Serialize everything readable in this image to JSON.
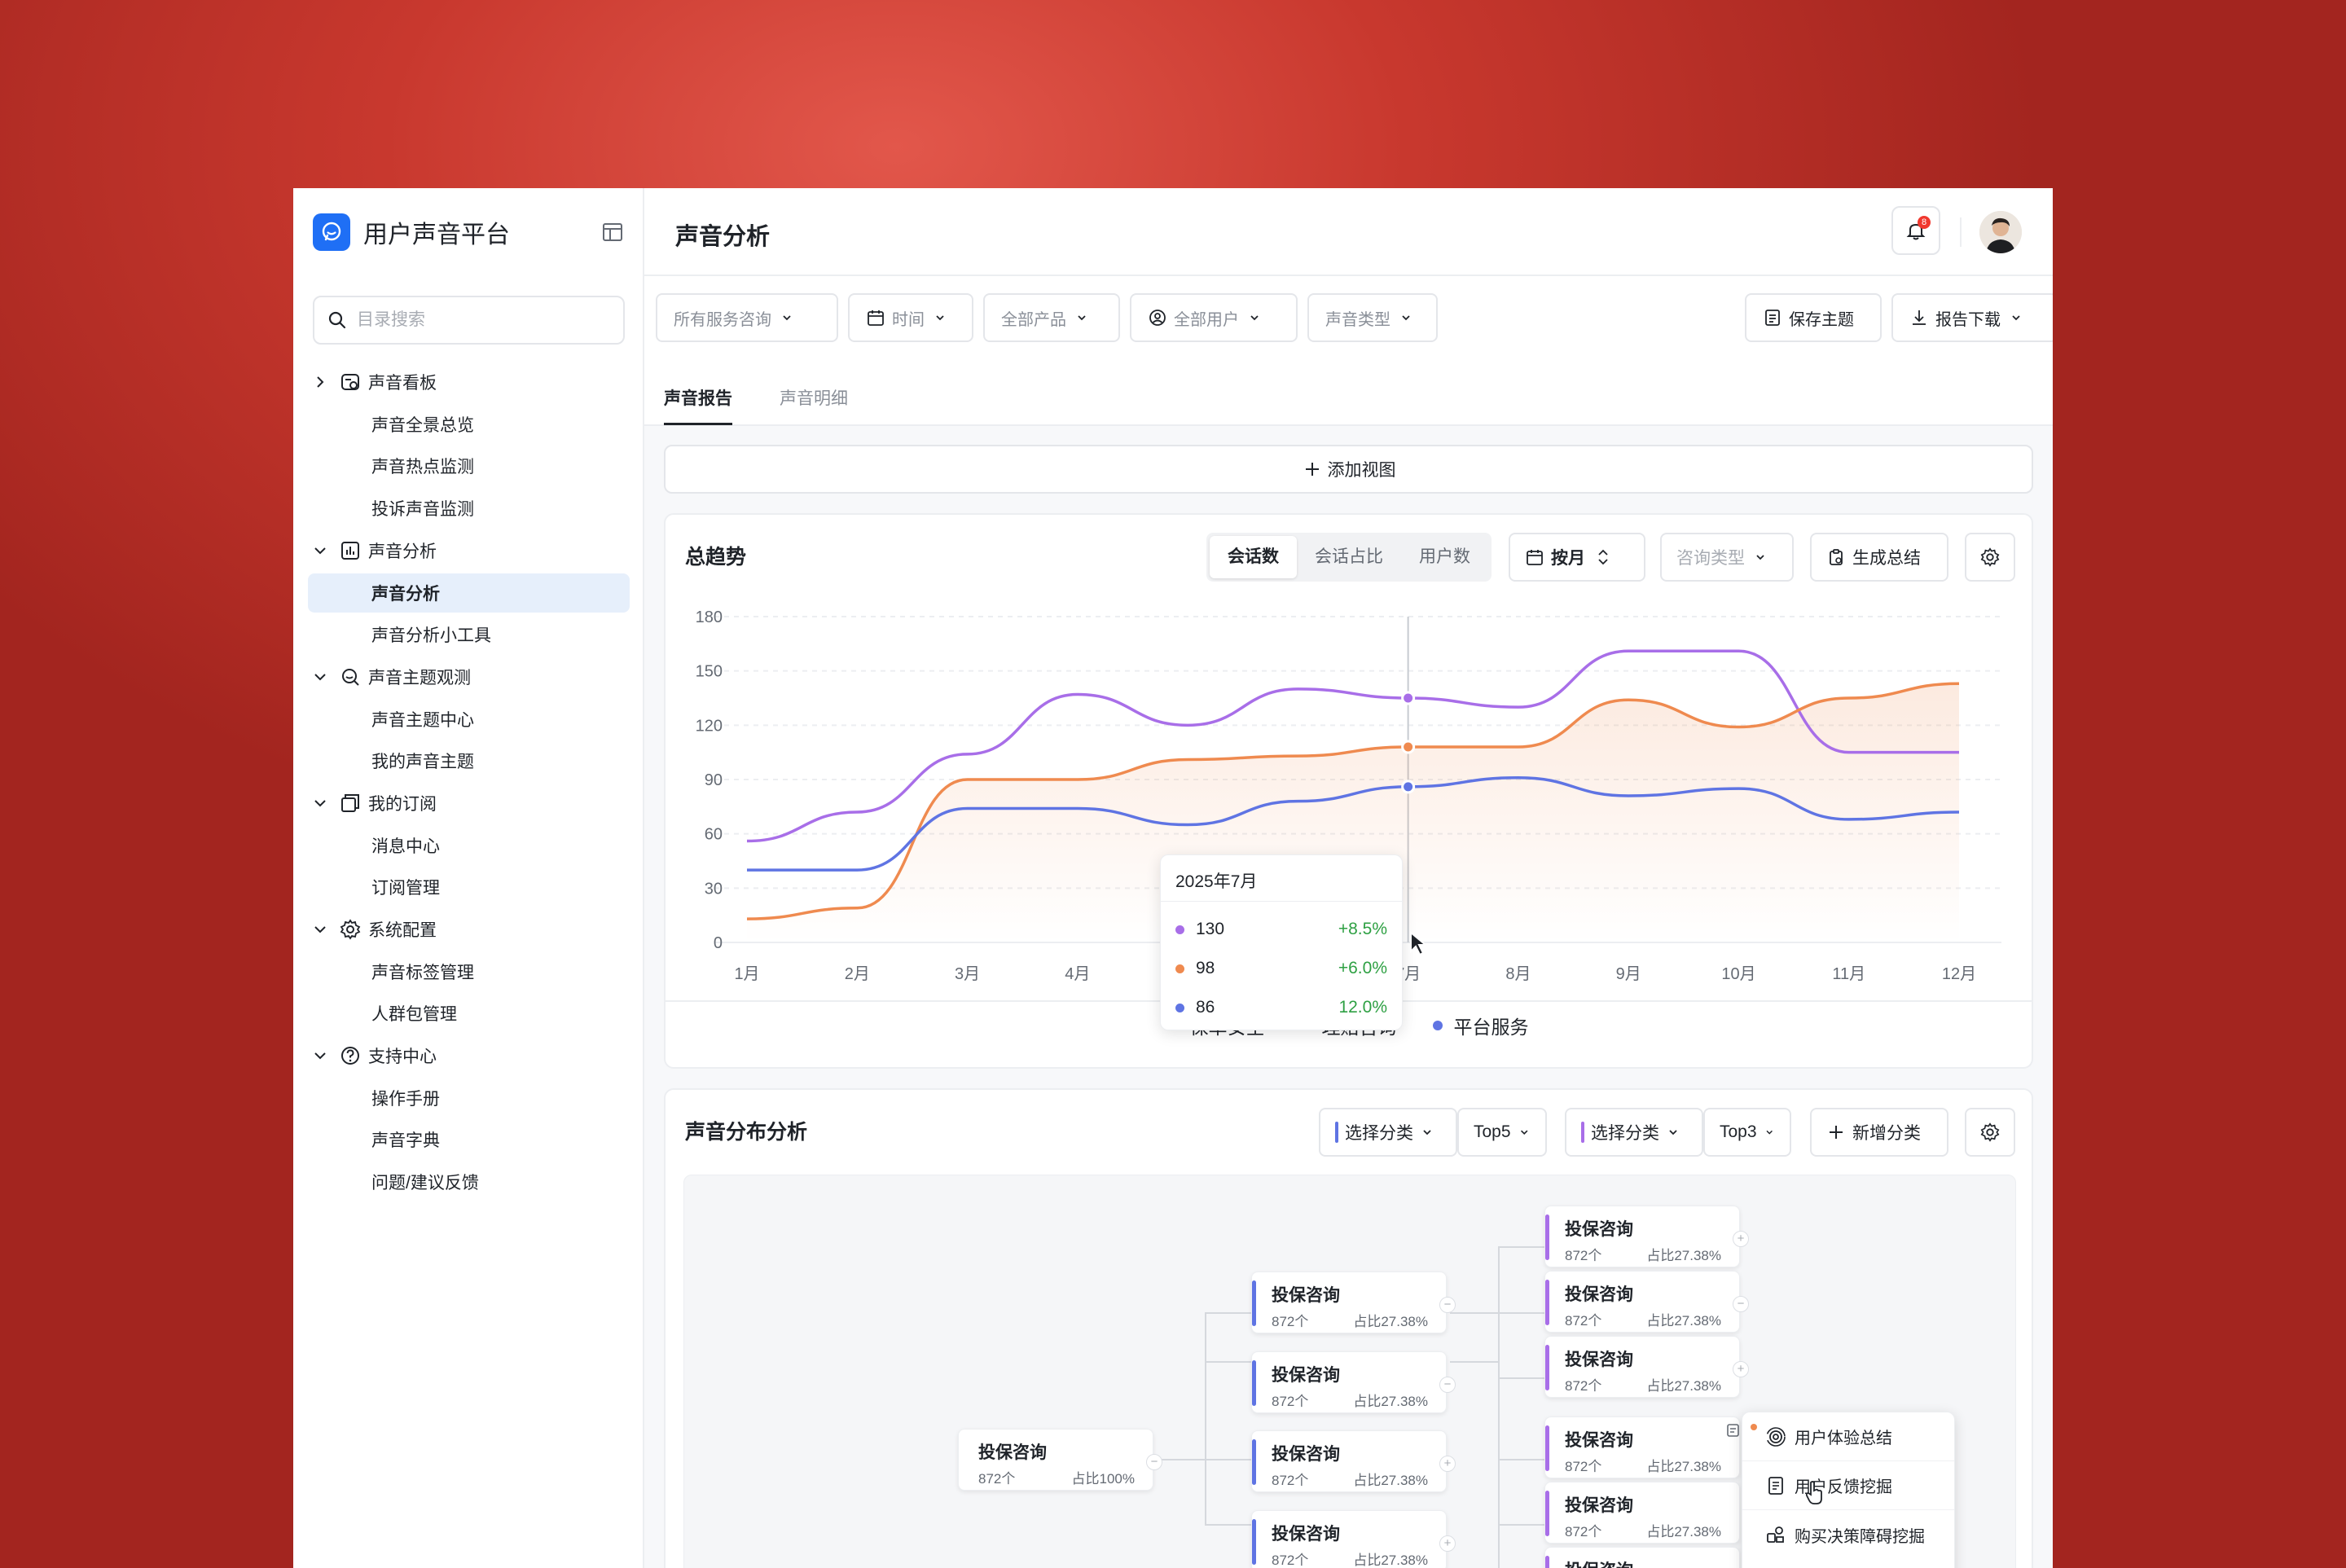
{
  "app": {
    "title": "用户声音平台"
  },
  "sidebar": {
    "search_placeholder": "目录搜索",
    "groups": [
      {
        "label": "声音看板",
        "items": [
          "声音全景总览",
          "声音热点监测",
          "投诉声音监测"
        ]
      },
      {
        "label": "声音分析",
        "items": [
          "声音分析",
          "声音分析小工具"
        ]
      },
      {
        "label": "声音主题观测",
        "items": [
          "声音主题中心",
          "我的声音主题"
        ]
      },
      {
        "label": "我的订阅",
        "items": [
          "消息中心",
          "订阅管理"
        ]
      },
      {
        "label": "系统配置",
        "items": [
          "声音标签管理",
          "人群包管理"
        ]
      },
      {
        "label": "支持中心",
        "items": [
          "操作手册",
          "声音字典",
          "问题/建议反馈"
        ]
      }
    ]
  },
  "header": {
    "title": "声音分析",
    "notification_count": "8"
  },
  "filters": {
    "service": "所有服务咨询",
    "time": "时间",
    "product": "全部产品",
    "users": "全部用户",
    "voice_type": "声音类型",
    "save_theme": "保存主题",
    "download": "报告下载"
  },
  "tabs": [
    "声音报告",
    "声音明细"
  ],
  "add_view": "添加视图",
  "trend_card": {
    "title": "总趋势",
    "segments": [
      "会话数",
      "会话占比",
      "用户数"
    ],
    "period": "按月",
    "consult_type": "咨询类型",
    "generate": "生成总结",
    "tooltip": {
      "title": "2025年7月",
      "rows": [
        {
          "value": "130",
          "change": "+8.5%"
        },
        {
          "value": "98",
          "change": "+6.0%"
        },
        {
          "value": "86",
          "change": "12.0%"
        }
      ]
    }
  },
  "chart_data": {
    "type": "line",
    "categories": [
      "1月",
      "2月",
      "3月",
      "4月",
      "5月",
      "6月",
      "7月",
      "8月",
      "9月",
      "10月",
      "11月",
      "12月"
    ],
    "ylim": [
      0,
      180
    ],
    "yticks": [
      180,
      150,
      120,
      90,
      60,
      30,
      0
    ],
    "series": [
      {
        "name": "保单安全",
        "color": "#a86ee8",
        "values": [
          56,
          72,
          104,
          137,
          120,
          140,
          135,
          130,
          161,
          161,
          105,
          105
        ]
      },
      {
        "name": "理赔咨询",
        "color": "#ef8a4f",
        "values": [
          13,
          19,
          90,
          90,
          101,
          103,
          108,
          108,
          134,
          119,
          135,
          143
        ]
      },
      {
        "name": "平台服务",
        "color": "#5f74e3",
        "values": [
          40,
          40,
          74,
          74,
          65,
          78,
          86,
          91,
          81,
          85,
          68,
          72
        ]
      }
    ],
    "highlight_index": 6
  },
  "dist_card": {
    "title": "声音分布分析",
    "select1": "选择分类",
    "top1": "Top5",
    "select2": "选择分类",
    "top2": "Top3",
    "add_category": "新增分类"
  },
  "tree": {
    "root": {
      "title": "投保咨询",
      "count": "872个",
      "pct": "占比100%"
    },
    "level1": [
      {
        "title": "投保咨询",
        "count": "872个",
        "pct": "占比27.38%"
      },
      {
        "title": "投保咨询",
        "count": "872个",
        "pct": "占比27.38%"
      },
      {
        "title": "投保咨询",
        "count": "872个",
        "pct": "占比27.38%"
      },
      {
        "title": "投保咨询",
        "count": "872个",
        "pct": "占比27.38%"
      }
    ],
    "level2": [
      {
        "title": "投保咨询",
        "count": "872个",
        "pct": "占比27.38%"
      },
      {
        "title": "投保咨询",
        "count": "872个",
        "pct": "占比27.38%"
      },
      {
        "title": "投保咨询",
        "count": "872个",
        "pct": "占比27.38%"
      },
      {
        "title": "投保咨询",
        "count": "872个",
        "pct": "占比27.38%"
      },
      {
        "title": "投保咨询",
        "count": "872个",
        "pct": "占比27.38%"
      },
      {
        "title": "投保咨询",
        "count": "",
        "pct": ""
      }
    ]
  },
  "context_menu": [
    "用户体验总结",
    "用户反馈挖掘",
    "购买决策障碍挖掘"
  ]
}
